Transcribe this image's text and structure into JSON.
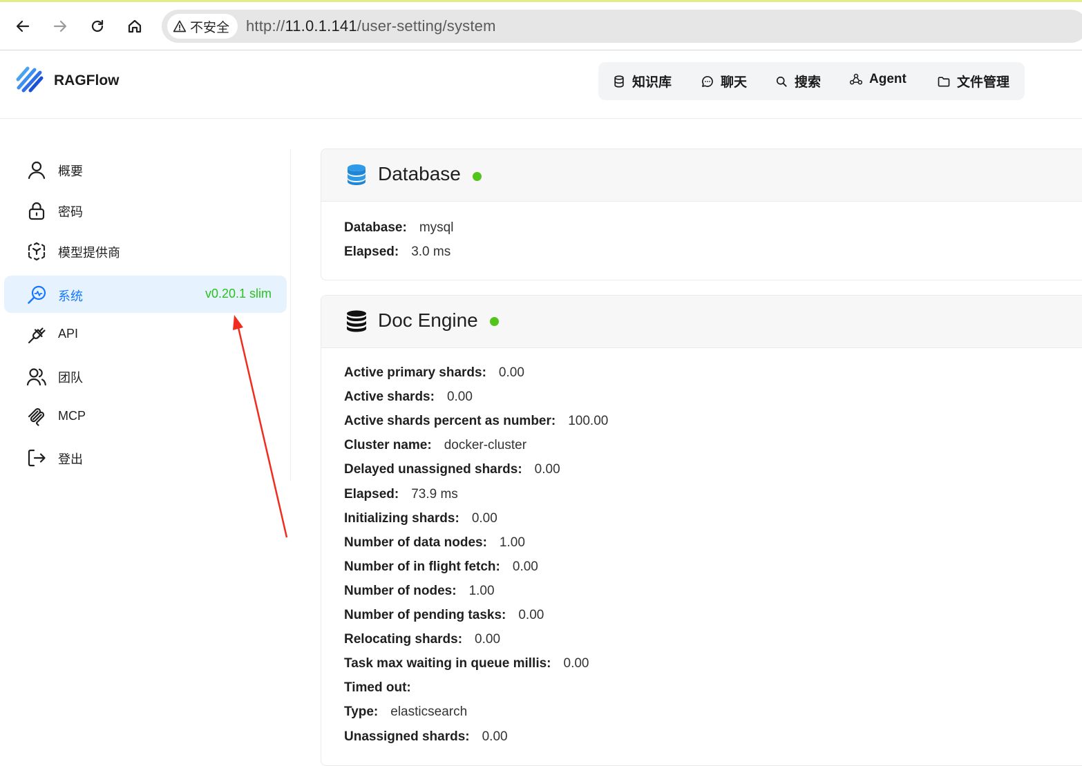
{
  "browser": {
    "security_label": "不安全",
    "url_scheme": "http://",
    "url_host": "11.0.1.141",
    "url_path": "/user-setting/system"
  },
  "app": {
    "name": "RAGFlow",
    "nav": [
      {
        "label": "知识库",
        "icon": "database-icon"
      },
      {
        "label": "聊天",
        "icon": "chat-icon"
      },
      {
        "label": "搜索",
        "icon": "search-icon"
      },
      {
        "label": "Agent",
        "icon": "agent-icon"
      },
      {
        "label": "文件管理",
        "icon": "folder-icon"
      }
    ]
  },
  "sidebar": {
    "items": [
      {
        "label": "概要",
        "icon": "user-icon"
      },
      {
        "label": "密码",
        "icon": "lock-icon"
      },
      {
        "label": "模型提供商",
        "icon": "model-icon"
      },
      {
        "label": "系统",
        "icon": "system-icon",
        "active": true,
        "version": "v0.20.1 slim"
      },
      {
        "label": "API",
        "icon": "plug-icon"
      },
      {
        "label": "团队",
        "icon": "team-icon"
      },
      {
        "label": "MCP",
        "icon": "mcp-icon"
      },
      {
        "label": "登出",
        "icon": "logout-icon"
      }
    ]
  },
  "database": {
    "title": "Database",
    "status_color": "#52c41a",
    "rows": [
      {
        "key": "Database:",
        "value": "mysql"
      },
      {
        "key": "Elapsed:",
        "value": "3.0 ms"
      }
    ]
  },
  "doc_engine": {
    "title": "Doc Engine",
    "status_color": "#52c41a",
    "rows": [
      {
        "key": "Active primary shards:",
        "value": "0.00"
      },
      {
        "key": "Active shards:",
        "value": "0.00"
      },
      {
        "key": "Active shards percent as number:",
        "value": "100.00"
      },
      {
        "key": "Cluster name:",
        "value": "docker-cluster"
      },
      {
        "key": "Delayed unassigned shards:",
        "value": "0.00"
      },
      {
        "key": "Elapsed:",
        "value": "73.9 ms"
      },
      {
        "key": "Initializing shards:",
        "value": "0.00"
      },
      {
        "key": "Number of data nodes:",
        "value": "1.00"
      },
      {
        "key": "Number of in flight fetch:",
        "value": "0.00"
      },
      {
        "key": "Number of nodes:",
        "value": "1.00"
      },
      {
        "key": "Number of pending tasks:",
        "value": "0.00"
      },
      {
        "key": "Relocating shards:",
        "value": "0.00"
      },
      {
        "key": "Task max waiting in queue millis:",
        "value": "0.00"
      },
      {
        "key": "Timed out:",
        "value": ""
      },
      {
        "key": "Type:",
        "value": "elasticsearch"
      },
      {
        "key": "Unassigned shards:",
        "value": "0.00"
      }
    ]
  },
  "colors": {
    "accent": "#1677ff",
    "version_green": "#29c11c",
    "active_bg": "#e6f3fe",
    "annotation_red": "#f22b1f"
  }
}
